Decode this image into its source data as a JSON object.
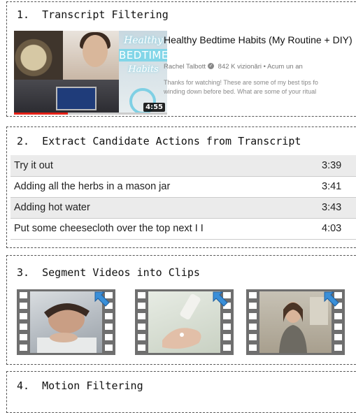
{
  "steps": [
    {
      "title": "1.  Transcript Filtering"
    },
    {
      "title": "2.  Extract Candidate Actions from Transcript"
    },
    {
      "title": "3.  Segment Videos into Clips"
    },
    {
      "title": "4.  Motion Filtering"
    }
  ],
  "video": {
    "thumbnail_text": [
      "Healthy",
      "BEDTIME",
      "Habits"
    ],
    "duration": "4:55",
    "watched_fraction": 0.35,
    "title": "Healthy Bedtime Habits (My Routine + DIY)",
    "channel": "Rachel Talbott",
    "verified_icon": "verified-check-icon",
    "meta": "842 K vizionări • Acum un an",
    "description_line1": "Thanks for watching! These are some of my best tips fo",
    "description_line2": "winding down before bed. What are some of your ritual"
  },
  "actions": [
    {
      "text": "Try it out",
      "time": "3:39"
    },
    {
      "text": "Adding all the herbs in a mason jar",
      "time": "3:41"
    },
    {
      "text": "Adding hot water",
      "time": "3:43"
    },
    {
      "text": "Put some cheesecloth over the top next I I",
      "time": "4:03"
    }
  ],
  "clips": [
    {
      "icon": "film-strip-icon",
      "badge_icon": "blue-arrow-icon"
    },
    {
      "icon": "film-strip-icon",
      "badge_icon": "blue-arrow-icon"
    },
    {
      "icon": "film-strip-icon",
      "badge_icon": "blue-arrow-icon"
    }
  ],
  "colors": {
    "progress": "#e62117",
    "badge": "#3a8fd8",
    "thumbnail_accent": "#82d6e8"
  }
}
